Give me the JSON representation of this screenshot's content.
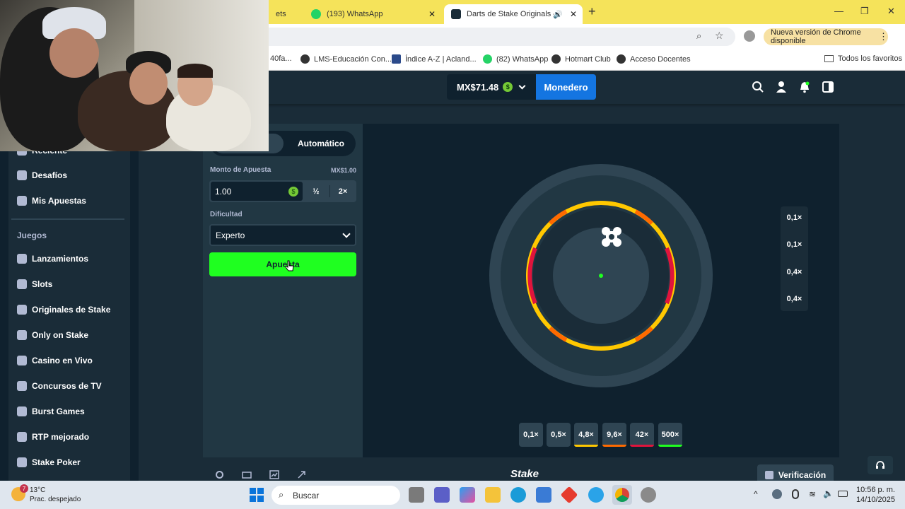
{
  "browser": {
    "tabs": [
      {
        "label": "ets",
        "active": false
      },
      {
        "label": "(193) WhatsApp",
        "active": false
      },
      {
        "label": "Darts de Stake Originals - J",
        "active": true
      }
    ],
    "update_notice": "Nueva versión de Chrome disponible",
    "bookmarks": [
      "40fa...",
      "LMS-Educación Con...",
      "Índice A-Z | Acland...",
      "(82) WhatsApp",
      "Hotmart Club",
      "Acceso Docentes"
    ],
    "all_bookmarks": "Todos los favoritos",
    "accent": "#f5e35a"
  },
  "header": {
    "balance": "MX$71.48",
    "coin_symbol": "$",
    "wallet_label": "Monedero",
    "icons": [
      "search-icon",
      "user-icon",
      "bell-icon",
      "sidebar-toggle-icon"
    ]
  },
  "sidebar": {
    "items_top": [
      {
        "label": "Reciente",
        "icon": "clock-icon"
      },
      {
        "label": "Desafíos",
        "icon": "trophy-icon"
      },
      {
        "label": "Mis Apuestas",
        "icon": "receipt-icon"
      }
    ],
    "games_heading": "Juegos",
    "items_games": [
      {
        "label": "Lanzamientos",
        "icon": "sparkle-icon"
      },
      {
        "label": "Slots",
        "icon": "slots-icon"
      },
      {
        "label": "Originales de Stake",
        "icon": "stake-icon"
      },
      {
        "label": "Only on Stake",
        "icon": "star-icon"
      },
      {
        "label": "Casino en Vivo",
        "icon": "live-icon"
      },
      {
        "label": "Concursos de TV",
        "icon": "tv-icon"
      },
      {
        "label": "Burst Games",
        "icon": "burst-icon"
      },
      {
        "label": "RTP mejorado",
        "icon": "rtp-icon"
      },
      {
        "label": "Stake Poker",
        "icon": "poker-icon"
      }
    ]
  },
  "panel": {
    "tab_auto": "Automático",
    "bet_amount_label": "Monto de Apuesta",
    "bet_amount_value_label": "MX$1.00",
    "bet_amount": "1.00",
    "half_label": "½",
    "double_label": "2×",
    "difficulty_label": "Dificultad",
    "difficulty_value": "Experto",
    "bet_button": "Apuesta",
    "bet_button_color": "#1fff20"
  },
  "game": {
    "side_multipliers": [
      "0,1×",
      "0,1×",
      "0,4×",
      "0,4×"
    ],
    "chips": [
      {
        "label": "0,1×",
        "color": ""
      },
      {
        "label": "0,5×",
        "color": ""
      },
      {
        "label": "4,8×",
        "color": "#ffc800"
      },
      {
        "label": "9,6×",
        "color": "#ff6a00"
      },
      {
        "label": "42×",
        "color": "#e0143c"
      },
      {
        "label": "500×",
        "color": "#1fff20"
      }
    ],
    "ring_colors": {
      "outer": "#2f4553",
      "yellow": "#ffc800",
      "orange": "#ff6a00",
      "red": "#e0143c",
      "center_dot": "#1fff20"
    }
  },
  "footer": {
    "brand": "Stake",
    "verify_label": "Verificación"
  },
  "taskbar": {
    "weather_temp": "13°C",
    "weather_desc": "Prac. despejado",
    "search_placeholder": "Buscar",
    "time": "10:56 p. m.",
    "date": "14/10/2025",
    "badge_count": "7"
  }
}
